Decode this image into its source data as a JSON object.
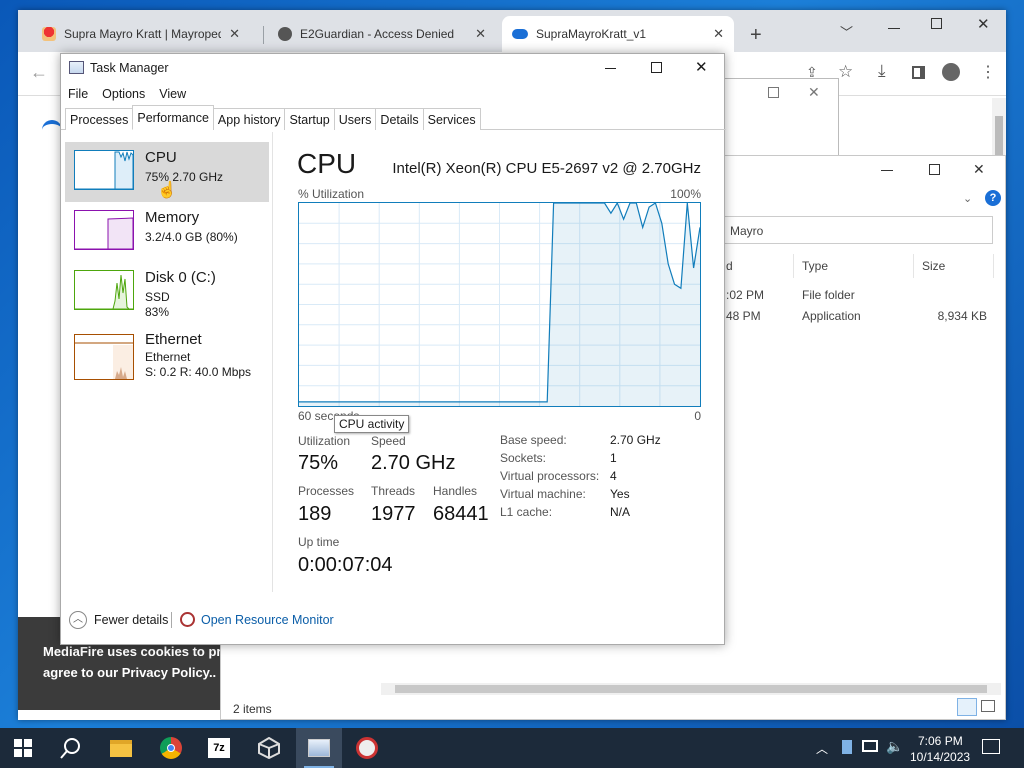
{
  "browser": {
    "tabs": [
      {
        "title": "Supra Mayro Kratt | Mayropedia"
      },
      {
        "title": "E2Guardian - Access Denied"
      },
      {
        "title": "SupraMayroKratt_v1"
      }
    ],
    "new_tab": "+"
  },
  "cookie_banner": {
    "line1": "MediaFire uses cookies to prov",
    "line2": "agree to our Privacy Policy.."
  },
  "explorer": {
    "search_text": "Mayro",
    "columns": [
      "d",
      "Type",
      "Size"
    ],
    "rows": [
      {
        "date": ":02 PM",
        "type": "File folder",
        "size": ""
      },
      {
        "date": "48 PM",
        "type": "Application",
        "size": "8,934 KB"
      }
    ],
    "status": "2 items"
  },
  "task_manager": {
    "title": "Task Manager",
    "menu": [
      "File",
      "Options",
      "View"
    ],
    "tabs": [
      "Processes",
      "Performance",
      "App history",
      "Startup",
      "Users",
      "Details",
      "Services"
    ],
    "active_tab": "Performance",
    "resources": [
      {
        "name": "CPU",
        "sub1": "75%  2.70 GHz",
        "sub2": "",
        "color": "#117dbb"
      },
      {
        "name": "Memory",
        "sub1": "3.2/4.0 GB (80%)",
        "sub2": "",
        "color": "#8b12ae"
      },
      {
        "name": "Disk 0 (C:)",
        "sub1": "SSD",
        "sub2": "83%",
        "color": "#4da60c"
      },
      {
        "name": "Ethernet",
        "sub1": "Ethernet",
        "sub2": "S: 0.2  R: 40.0 Mbps",
        "color": "#a74f01"
      }
    ],
    "detail": {
      "heading": "CPU",
      "model": "Intel(R) Xeon(R) CPU E5-2697 v2 @ 2.70GHz",
      "graph_label": "% Utilization",
      "graph_max": "100%",
      "graph_time": "60 seconds",
      "graph_min": "0",
      "tooltip": "CPU activity",
      "stats": {
        "utilization_label": "Utilization",
        "utilization": "75%",
        "speed_label": "Speed",
        "speed": "2.70 GHz",
        "processes_label": "Processes",
        "processes": "189",
        "threads_label": "Threads",
        "threads": "1977",
        "handles_label": "Handles",
        "handles": "68441",
        "uptime_label": "Up time",
        "uptime": "0:00:07:04"
      },
      "specs": [
        {
          "k": "Base speed:",
          "v": "2.70 GHz"
        },
        {
          "k": "Sockets:",
          "v": "1"
        },
        {
          "k": "Virtual processors:",
          "v": "4"
        },
        {
          "k": "Virtual machine:",
          "v": "Yes"
        },
        {
          "k": "L1 cache:",
          "v": "N/A"
        }
      ]
    },
    "footer": {
      "fewer": "Fewer details",
      "monitor": "Open Resource Monitor"
    },
    "cpu_history": [
      2,
      2,
      2,
      2,
      2,
      2,
      2,
      2,
      2,
      2,
      2,
      2,
      2,
      2,
      2,
      2,
      2,
      2,
      2,
      2,
      2,
      2,
      2,
      2,
      2,
      2,
      2,
      2,
      2,
      2,
      2,
      2,
      2,
      2,
      2,
      2,
      2,
      2,
      2,
      2,
      100,
      100,
      100,
      100,
      100,
      100,
      100,
      100,
      100,
      95,
      100,
      92,
      100,
      100,
      88,
      98,
      100,
      90,
      70,
      60,
      58,
      100,
      68,
      88
    ]
  },
  "taskbar": {
    "time": "7:06 PM",
    "date": "10/14/2023"
  }
}
